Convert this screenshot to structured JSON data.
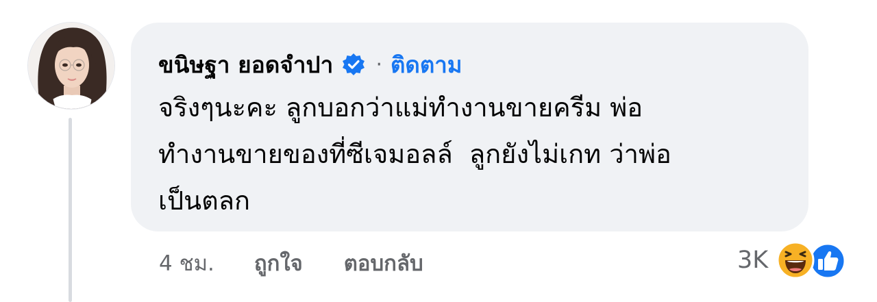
{
  "comment": {
    "author": "ขนิษฐา ยอดจำปา",
    "verified": true,
    "separator": "·",
    "follow_label": "ติดตาม",
    "text": "จริงๆนะคะ ลูกบอกว่าแม่ทำงานขายครีม พ่อ\nทำงานขายของที่ซีเจมอลล์  ลูกยังไม่เกท ว่าพ่อ\nเป็นตลก",
    "time": "4 ชม.",
    "like_label": "ถูกใจ",
    "reply_label": "ตอบกลับ",
    "reaction_count": "3K",
    "reaction_icons": [
      "haha-reaction-icon",
      "like-reaction-icon"
    ]
  },
  "colors": {
    "bubble": "#f0f2f5",
    "link": "#1877f2",
    "muted": "#65676b",
    "text": "#050505",
    "verified": "#1877f2",
    "haha": "#f7b125"
  }
}
